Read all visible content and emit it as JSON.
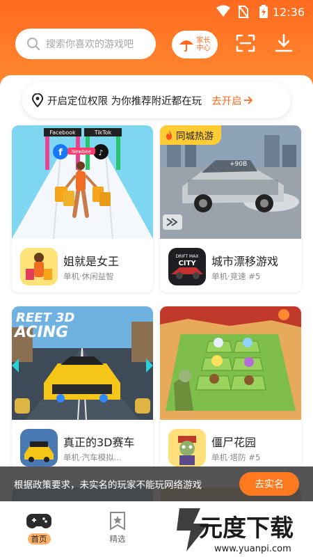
{
  "status_bar": {
    "time": "12:36"
  },
  "header": {
    "search_placeholder": "搜索你喜欢的游戏吧",
    "parent_center_label": "家长中心"
  },
  "location_banner": {
    "text": "开启定位权限 为你推荐附近都在玩",
    "action": "去开启"
  },
  "games": [
    {
      "name": "姐就是女王",
      "meta": "单机·休闲益智",
      "screenshot_labels": [
        "Facebook",
        "TikTok",
        "Newbee"
      ]
    },
    {
      "name": "城市漂移游戏",
      "meta": "单机·竞速 #5",
      "tag": "同城热游",
      "screenshot_labels": [
        "+90B"
      ],
      "icon_text": [
        "DRIFT MAX",
        "CITY"
      ]
    },
    {
      "name": "真正的3D赛车",
      "meta": "单机·汽车模拟...",
      "screenshot_labels": [
        "REET 3D",
        "ACING"
      ]
    },
    {
      "name": "僵尸花园",
      "meta": "单机·塔防 #5"
    }
  ],
  "toast": {
    "message": "根据政策要求，未实名的玩家不能玩网络游戏",
    "button": "去实名"
  },
  "tabs": [
    {
      "label": "首页",
      "icon": "gamepad-icon",
      "active": true
    },
    {
      "label": "精选",
      "icon": "star-bookmark-icon",
      "active": false
    }
  ],
  "watermark": {
    "text": "元度下载",
    "url": "www.yuanpi.com"
  },
  "colors": {
    "accent": "#ff6a1f",
    "tag": "#ffcc33",
    "toast_bg": "#3c3c3c"
  }
}
